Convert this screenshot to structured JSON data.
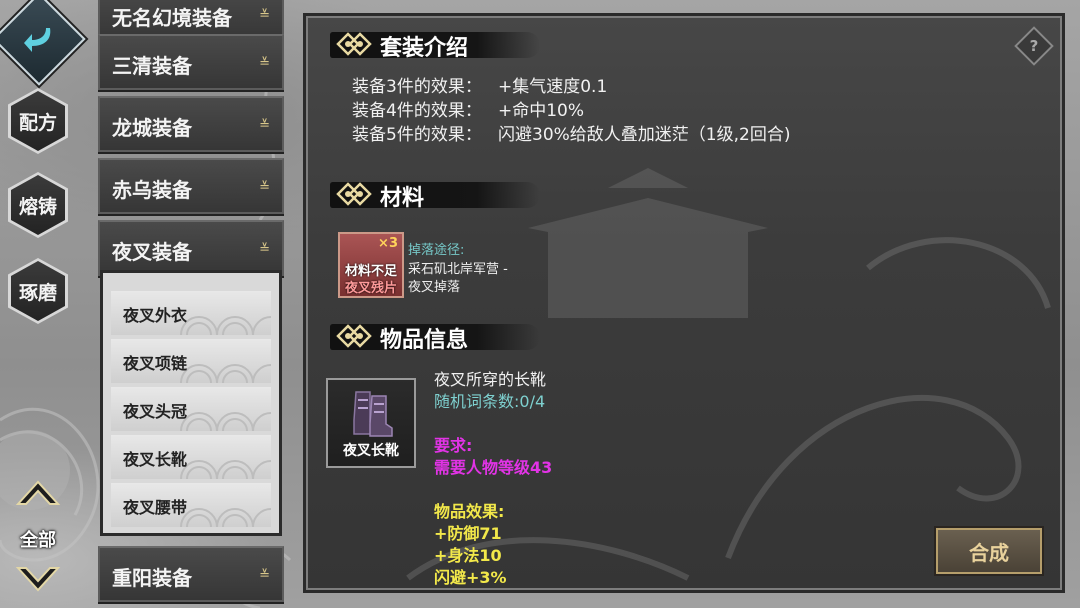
{
  "nav": {
    "recipe": "配方",
    "casting": "熔铸",
    "polish": "琢磨",
    "all": "全部"
  },
  "categories": [
    {
      "name": "无名幻境装备"
    },
    {
      "name": "三清装备"
    },
    {
      "name": "龙城装备"
    },
    {
      "name": "赤乌装备"
    },
    {
      "name": "夜叉装备"
    },
    {
      "name": "重阳装备"
    }
  ],
  "sub_items": [
    {
      "name": "夜叉外衣"
    },
    {
      "name": "夜叉项链"
    },
    {
      "name": "夜叉头冠"
    },
    {
      "name": "夜叉长靴"
    },
    {
      "name": "夜叉腰带"
    }
  ],
  "set_intro": {
    "title": "套装介绍",
    "effects": [
      {
        "label": "装备3件的效果：",
        "value": "+集气速度0.1"
      },
      {
        "label": "装备4件的效果：",
        "value": "+命中10%"
      },
      {
        "label": "装备5件的效果：",
        "value": "闪避30%给敌人叠加迷茫（1级,2回合)"
      }
    ]
  },
  "materials": {
    "title": "材料",
    "item": {
      "count": "×3",
      "status": "材料不足",
      "name": "夜叉残片"
    },
    "drop_title": "掉落途径:",
    "drop_lines": [
      "采石矶北岸军营 -",
      "夜叉掉落"
    ]
  },
  "item_info": {
    "title": "物品信息",
    "icon_name": "夜叉长靴",
    "description": "夜叉所穿的长靴",
    "affixes": "随机词条数:0/4",
    "requirement_title": "要求:",
    "requirement": "需要人物等级43",
    "effect_title": "物品效果:",
    "effects": [
      "+防御71",
      "+身法10",
      "闪避+3%"
    ]
  },
  "craft_button": "合成",
  "help_icon": "?",
  "colors": {
    "teal": "#7ed0cf",
    "magenta": "#e233e6",
    "yellow": "#f2e84a",
    "gold": "#d9c78a"
  }
}
